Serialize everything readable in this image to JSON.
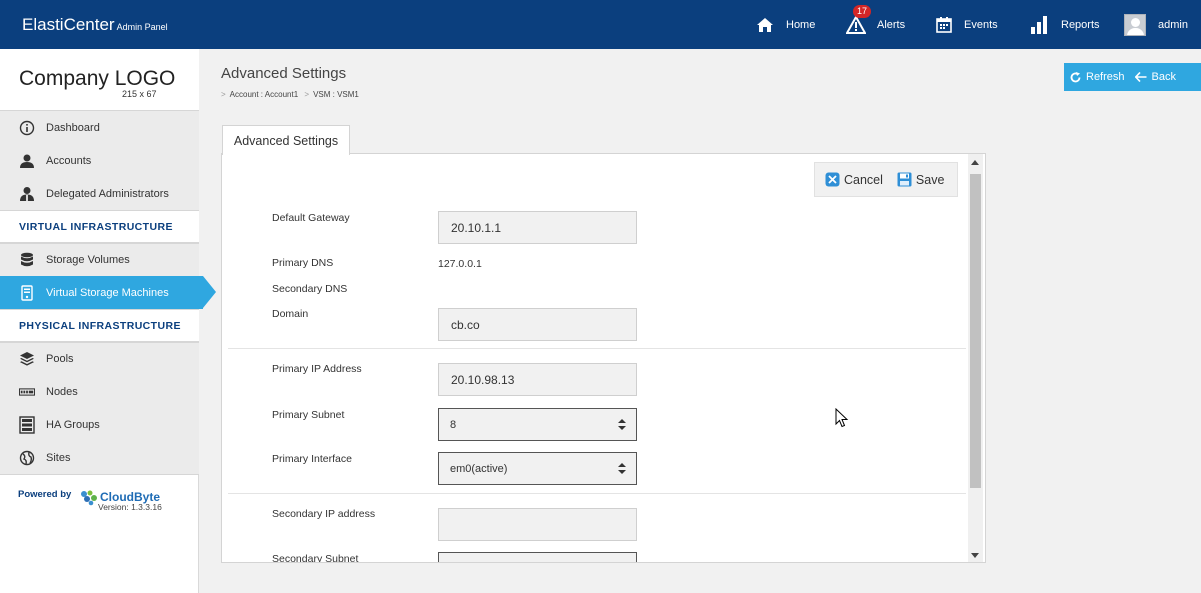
{
  "header": {
    "brand": "ElastiCenter",
    "brand_sub": "Admin Panel",
    "nav": {
      "home": "Home",
      "alerts": "Alerts",
      "alerts_count": "17",
      "events": "Events",
      "reports": "Reports",
      "user": "admin"
    }
  },
  "sidebar": {
    "logo": "Company LOGO",
    "logo_size": "215 x 67",
    "items": [
      {
        "label": "Dashboard",
        "icon": "info-icon"
      },
      {
        "label": "Accounts",
        "icon": "user-icon"
      },
      {
        "label": "Delegated Administrators",
        "icon": "admin-user-icon"
      }
    ],
    "section_virtual": "VIRTUAL INFRASTRUCTURE",
    "virtual_items": [
      {
        "label": "Storage Volumes",
        "icon": "database-icon"
      },
      {
        "label": "Virtual Storage Machines",
        "icon": "vsm-icon",
        "active": true
      }
    ],
    "section_physical": "PHYSICAL INFRASTRUCTURE",
    "physical_items": [
      {
        "label": "Pools",
        "icon": "layers-icon"
      },
      {
        "label": "Nodes",
        "icon": "node-icon"
      },
      {
        "label": "HA Groups",
        "icon": "rack-icon"
      },
      {
        "label": "Sites",
        "icon": "globe-icon"
      }
    ],
    "powered_by": "Powered by",
    "vendor": "CloudByte",
    "version": "Version: 1.3.3.16"
  },
  "main": {
    "title": "Advanced Settings",
    "breadcrumb": [
      "Account : Account1",
      "VSM : VSM1"
    ],
    "refresh_label": "Refresh",
    "back_label": "Back",
    "tab_label": "Advanced Settings",
    "cancel_label": "Cancel",
    "save_label": "Save",
    "fields": {
      "default_gateway_label": "Default Gateway",
      "default_gateway_value": "20.10.1.1",
      "primary_dns_label": "Primary DNS",
      "primary_dns_value": "127.0.0.1",
      "secondary_dns_label": "Secondary DNS",
      "domain_label": "Domain",
      "domain_value": "cb.co",
      "primary_ip_label": "Primary IP Address",
      "primary_ip_value": "20.10.98.13",
      "primary_subnet_label": "Primary Subnet",
      "primary_subnet_value": "8",
      "primary_interface_label": "Primary Interface",
      "primary_interface_value": "em0(active)",
      "secondary_ip_label": "Secondary IP address",
      "secondary_ip_value": "",
      "secondary_subnet_label": "Secondary Subnet"
    }
  },
  "colors": {
    "header_bg": "#0b3f7e",
    "accent": "#2fa7e0",
    "badge": "#d32626"
  }
}
